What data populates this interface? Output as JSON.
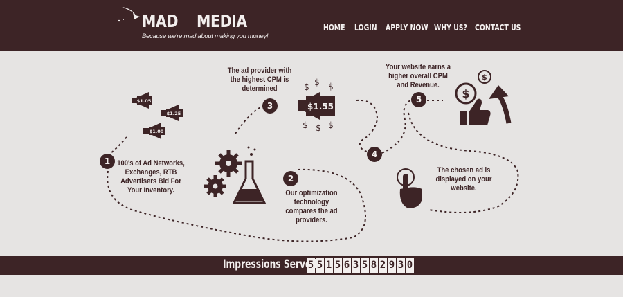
{
  "brand": {
    "name_left": "MAD",
    "name_right": "MEDIA",
    "tagline": "Because we're mad about making you money!"
  },
  "nav": {
    "items": [
      "HOME",
      "LOGIN",
      "APPLY NOW",
      "WHY US?",
      "CONTACT US"
    ]
  },
  "infographic": {
    "steps": [
      {
        "number": "1",
        "text": "100's of Ad Networks, Exchanges, RTB Advertisers Bid For Your Inventory."
      },
      {
        "number": "2",
        "text": "Our optimization technology compares the ad providers."
      },
      {
        "number": "3",
        "text": "The ad provider with the highest CPM is determined"
      },
      {
        "number": "4",
        "text": ""
      },
      {
        "number": "5",
        "text": "Your website earns a higher overall CPM and Revenue."
      }
    ],
    "chosen_ad_text": "The chosen ad is displayed on your website.",
    "bid_prices": [
      "$1.05",
      "$1.25",
      "$1.00"
    ],
    "winning_price": "$1.55"
  },
  "footer": {
    "impressions_label": "Impressions Served:",
    "impressions_digits": [
      "5",
      "5",
      "1",
      "5",
      "6",
      "3",
      "5",
      "8",
      "2",
      "9",
      "3",
      "0"
    ]
  },
  "colors": {
    "brand_dark": "#3d2426",
    "background": "#e6e4e3",
    "light_text": "#f3efee"
  }
}
